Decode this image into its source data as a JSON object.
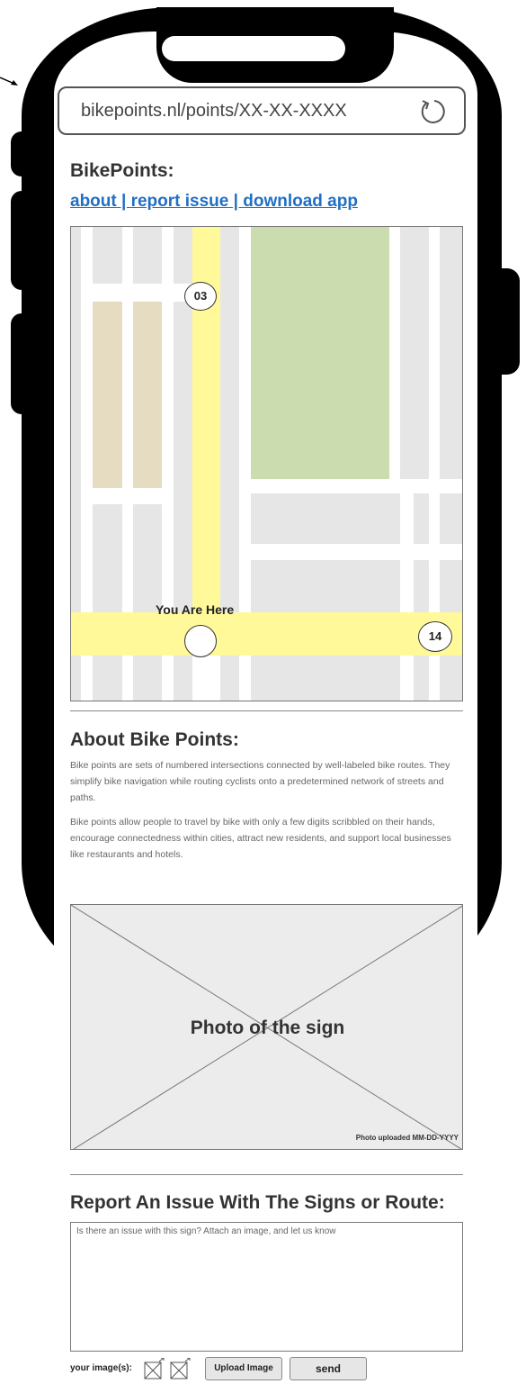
{
  "browser": {
    "url": "bikepoints.nl/points/XX-XX-XXXX",
    "reload_icon": "reload-icon"
  },
  "header": {
    "title": "BikePoints:",
    "nav": {
      "about": "about",
      "sep1": " | ",
      "report": "report issue",
      "sep2": " | ",
      "download": "download app"
    }
  },
  "map": {
    "markers": [
      {
        "label": "03"
      },
      {
        "label": "14"
      }
    ],
    "you_are_here": "You Are Here",
    "colors": {
      "block": "#e6e6e6",
      "street": "#ffffff",
      "bike_route": "#fff99a",
      "park": "#cbddaf",
      "building": "#e6dcc1"
    }
  },
  "about": {
    "title": "About Bike Points:",
    "p1": "Bike points are sets of numbered intersections connected by well-labeled bike routes.  They simplify bike navigation while routing cyclists onto a predetermined network of streets and paths.",
    "p2": "Bike points allow people to travel by bike with only a few digits scribbled on their hands, encourage connectedness within cities, attract new residents, and support local businesses like restaurants and hotels."
  },
  "photo": {
    "label": "Photo of the sign",
    "uploaded": "Photo uploaded MM-DD-YYYY"
  },
  "report": {
    "title": "Report An Issue With The Signs or Route:",
    "placeholder": "Is there an issue with this sign? Attach an image, and let us know",
    "images_label": "your image(s):",
    "upload_label": "Upload Image",
    "send_label": "send"
  }
}
